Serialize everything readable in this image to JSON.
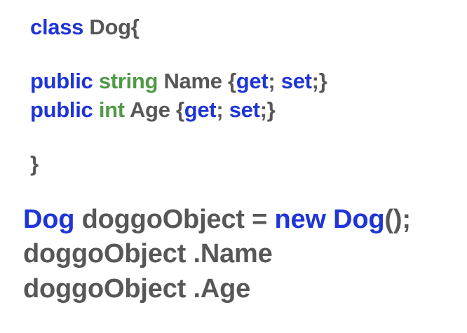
{
  "class_block": {
    "kw_class": "class",
    "class_name": "Dog{",
    "line_name": {
      "kw_public": "public",
      "type": "string",
      "prop": "Name",
      "open": "{",
      "kw_get": "get",
      "semi_get": ";",
      "kw_set": "set",
      "close": ";}"
    },
    "line_age": {
      "kw_public": "public",
      "type": "int",
      "prop": "Age",
      "open": "{",
      "kw_get": "get",
      "semi_get": ";",
      "kw_set": "set",
      "close": ";}"
    },
    "close_brace": "}"
  },
  "usage": {
    "line_new": {
      "type": "Dog",
      "var": "doggoObject",
      "op": "=",
      "kw_new": "new",
      "ctor": "Dog",
      "tail": "();"
    },
    "line_name_access": "doggoObject .Name",
    "line_age_access": "doggoObject .Age"
  },
  "colors": {
    "keyword": "#1f35d6",
    "type": "#4f9a46",
    "text": "#575757",
    "background": "#ffffff"
  }
}
